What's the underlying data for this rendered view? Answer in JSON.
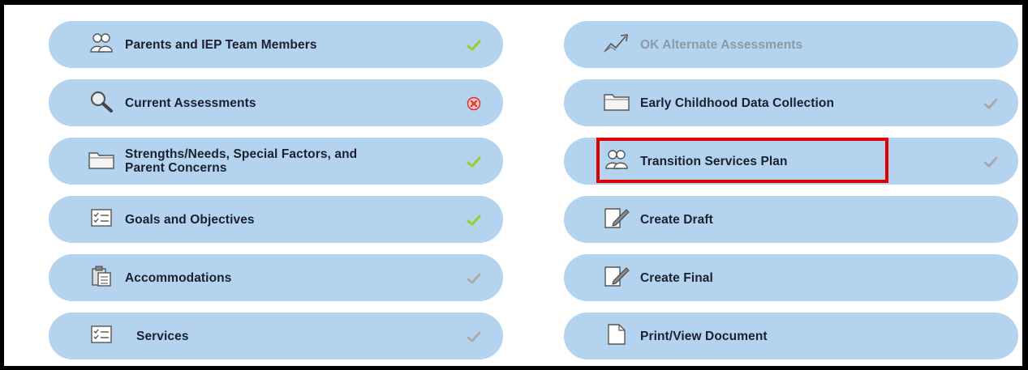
{
  "left_column": [
    {
      "label": "Parents and IEP Team Members",
      "icon": "people-icon",
      "status": "complete"
    },
    {
      "label": "Current Assessments",
      "icon": "magnifier-icon",
      "status": "error"
    },
    {
      "label_line1": "Strengths/Needs, Special Factors, and",
      "label_line2": "Parent Concerns",
      "icon": "folder-icon",
      "status": "complete"
    },
    {
      "label": "Goals and Objectives",
      "icon": "checklist-icon",
      "status": "complete"
    },
    {
      "label": "Accommodations",
      "icon": "clipboard-icon",
      "status": "neutral"
    },
    {
      "label": "Services",
      "icon": "checklist-icon",
      "status": "neutral"
    }
  ],
  "right_column": [
    {
      "label": "OK Alternate Assessments",
      "icon": "chart-arrow-icon",
      "status": "disabled"
    },
    {
      "label": "Early Childhood Data Collection",
      "icon": "folder-icon",
      "status": "neutral"
    },
    {
      "label": "Transition Services Plan",
      "icon": "people-icon",
      "status": "neutral",
      "highlighted": true
    },
    {
      "label": "Create Draft",
      "icon": "edit-document-icon",
      "status": "none"
    },
    {
      "label": "Create Final",
      "icon": "edit-document-icon",
      "status": "none"
    },
    {
      "label": "Print/View Document",
      "icon": "document-icon",
      "status": "none"
    }
  ],
  "colors": {
    "tile_bg": "#b4d3ee",
    "check_green": "#9acd32",
    "check_gray": "#a9a9a9",
    "error_red": "#d9302a",
    "highlight_border": "#e00000"
  }
}
